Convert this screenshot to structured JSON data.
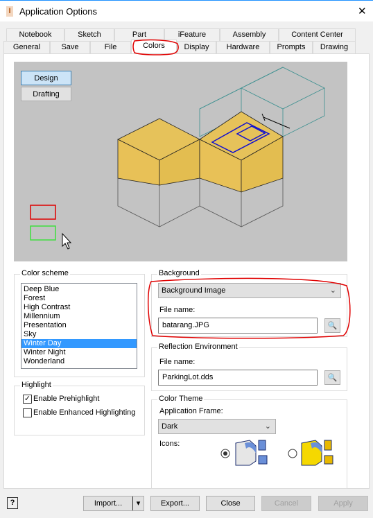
{
  "window": {
    "title": "Application Options",
    "close": "✕"
  },
  "tabs": {
    "row1": [
      "Notebook",
      "Sketch",
      "Part",
      "iFeature",
      "Assembly",
      "Content Center"
    ],
    "row2": [
      "General",
      "Save",
      "File",
      "Colors",
      "Display",
      "Hardware",
      "Prompts",
      "Drawing"
    ],
    "active": "Colors"
  },
  "preview": {
    "design": "Design",
    "drafting": "Drafting"
  },
  "color_scheme": {
    "label": "Color scheme",
    "items": [
      "Deep Blue",
      "Forest",
      "High Contrast",
      "Millennium",
      "Presentation",
      "Sky",
      "Winter Day",
      "Winter Night",
      "Wonderland"
    ],
    "selected": "Winter Day"
  },
  "highlight": {
    "label": "Highlight",
    "prehighlight": "Enable Prehighlight",
    "prehighlight_checked": true,
    "enhanced": "Enable Enhanced Highlighting",
    "enhanced_checked": false
  },
  "background": {
    "label": "Background",
    "type": "Background Image",
    "file_label": "File name:",
    "file": "batarang.JPG"
  },
  "reflection": {
    "label": "Reflection Environment",
    "file_label": "File name:",
    "file": "ParkingLot.dds"
  },
  "color_theme": {
    "label": "Color Theme",
    "frame_label": "Application Frame:",
    "frame": "Dark",
    "icons_label": "Icons:",
    "icons_selected": "blue"
  },
  "footer": {
    "help": "?",
    "import": "Import...",
    "export": "Export...",
    "close": "Close",
    "cancel": "Cancel",
    "apply": "Apply"
  },
  "colors": {
    "accent": "#3399ff",
    "cube": "#e6c25a",
    "annotation": "#e00000"
  }
}
